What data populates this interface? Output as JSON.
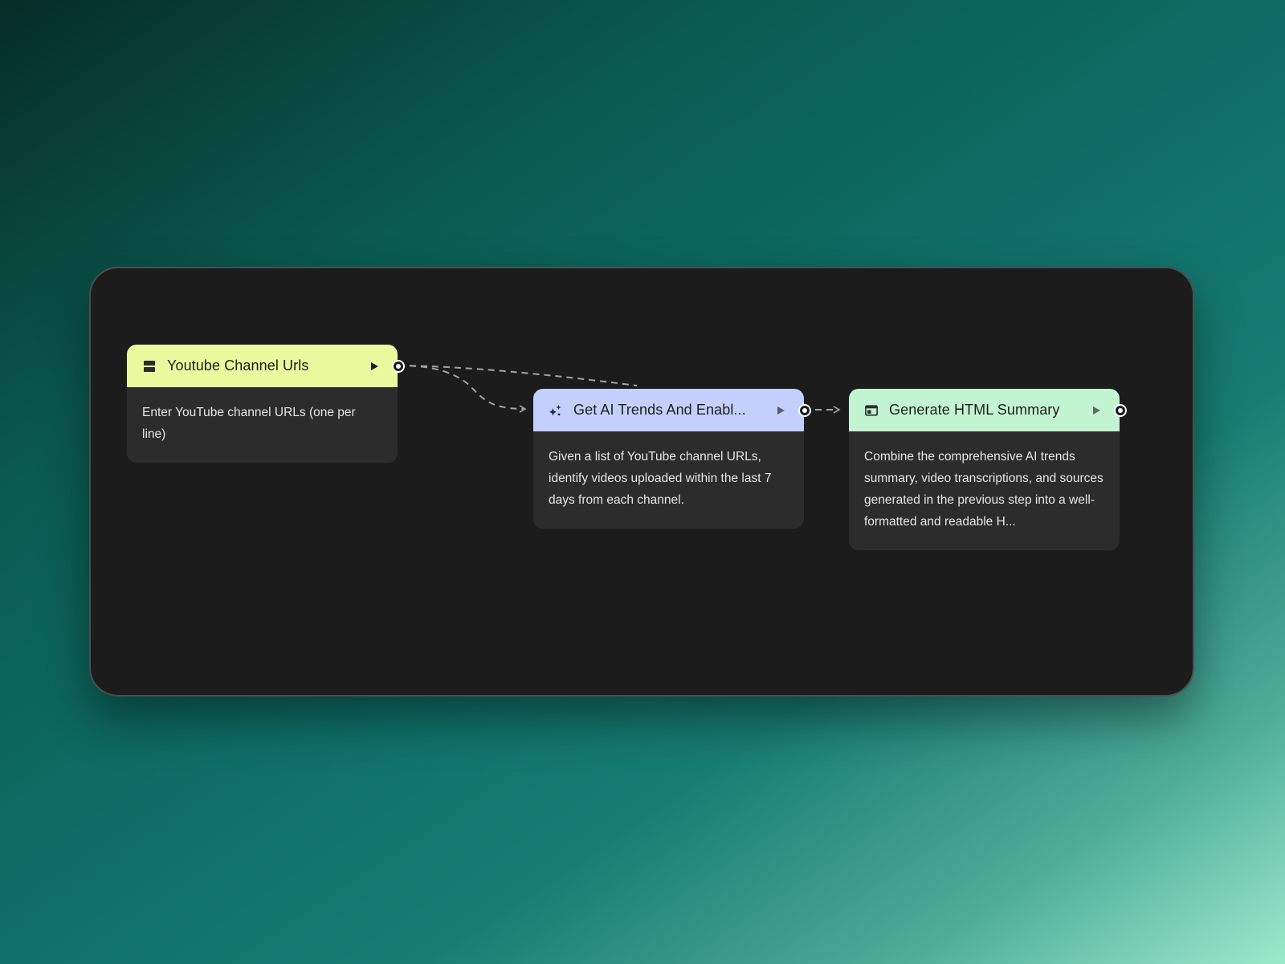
{
  "nodes": [
    {
      "title": "Youtube Channel Urls",
      "description": "Enter YouTube channel URLs (one per line)",
      "icon": "input-icon",
      "header_color": "#eaf99e"
    },
    {
      "title": "Get AI Trends And Enabl...",
      "description": "Given a list of YouTube channel URLs, identify videos uploaded within the last 7 days from each channel.",
      "icon": "sparkle-icon",
      "header_color": "#c3d0fb"
    },
    {
      "title": "Generate HTML Summary",
      "description": "Combine the comprehensive AI trends summary, video transcriptions, and sources generated in the previous step into a well-formatted and readable H...",
      "icon": "web-page-icon",
      "header_color": "#c2f4d2"
    }
  ],
  "colors": {
    "background_gradient_start": "#062d26",
    "background_gradient_end": "#9de9cd",
    "canvas_bg": "#1c1c1c",
    "node_body_bg": "#2c2c2c",
    "edge": "#a3a3a3"
  }
}
